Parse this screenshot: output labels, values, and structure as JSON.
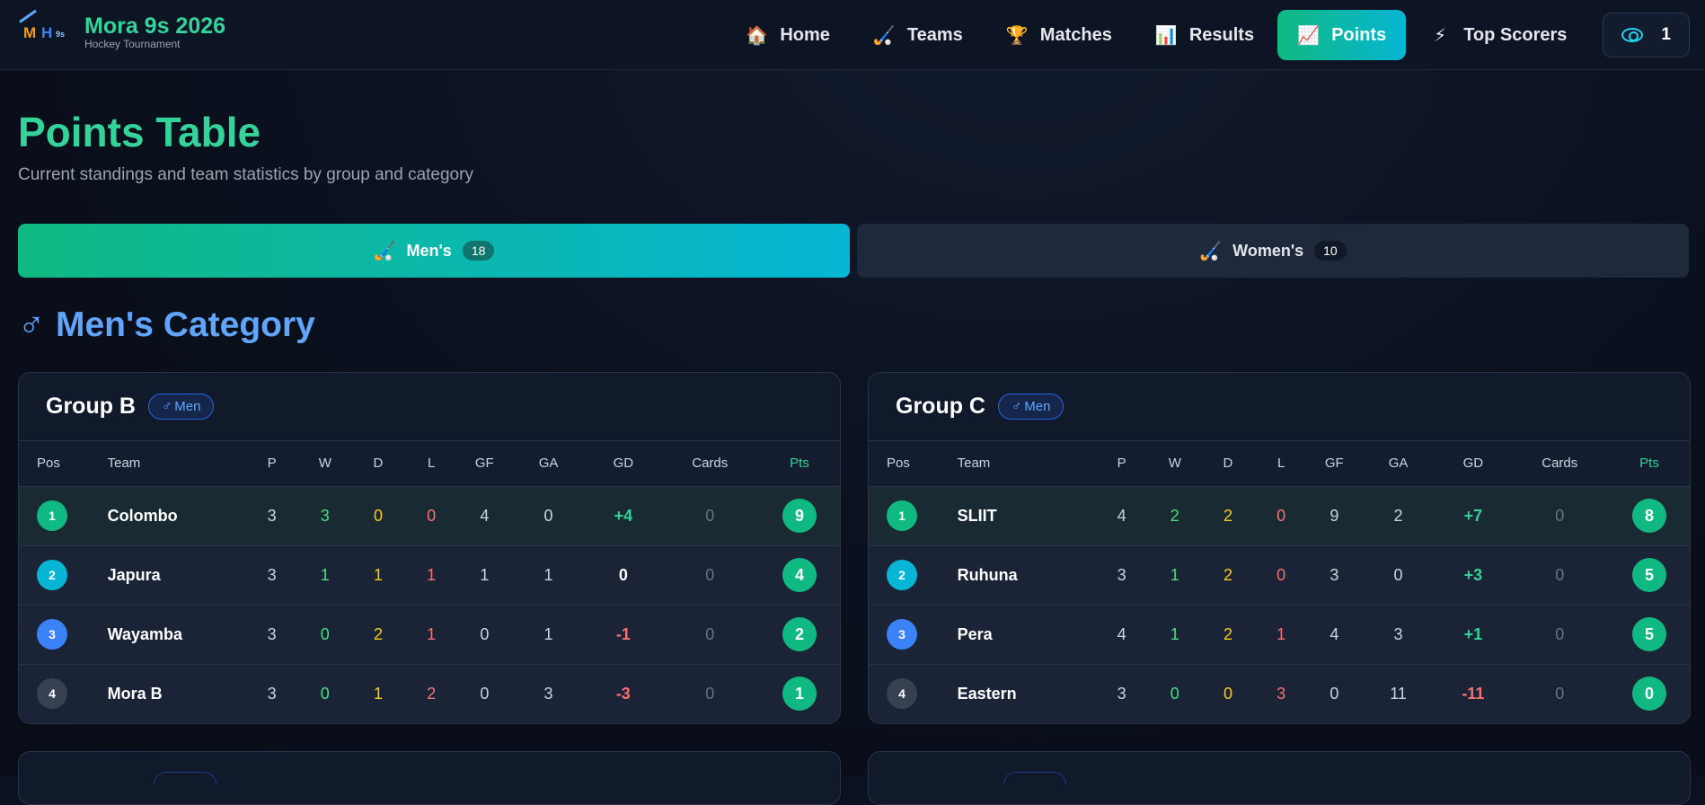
{
  "brand": {
    "logo_m": "M",
    "logo_h": "H",
    "logo_s": "9s",
    "title": "Mora 9s 2026",
    "subtitle": "Hockey Tournament"
  },
  "nav": {
    "items": [
      {
        "label": "Home",
        "icon": "house-icon",
        "glyph": "🏠"
      },
      {
        "label": "Teams",
        "icon": "hockey-stick-icon",
        "glyph": "🏑"
      },
      {
        "label": "Matches",
        "icon": "trophy-icon",
        "glyph": "🏆"
      },
      {
        "label": "Results",
        "icon": "bar-chart-icon",
        "glyph": "📊"
      },
      {
        "label": "Points",
        "icon": "line-chart-icon",
        "glyph": "📈",
        "active": true
      },
      {
        "label": "Top Scorers",
        "icon": "lightning-icon",
        "glyph": "⚡"
      }
    ],
    "visits": "1"
  },
  "page": {
    "title": "Points Table",
    "subtitle": "Current standings and team statistics by group and category"
  },
  "tabs": [
    {
      "label": "Men's",
      "count": "18",
      "glyph": "🏑",
      "active": true
    },
    {
      "label": "Women's",
      "count": "10",
      "glyph": "🏑",
      "active": false
    }
  ],
  "category": {
    "symbol": "♂",
    "label": "Men's Category"
  },
  "columns": [
    "Pos",
    "Team",
    "P",
    "W",
    "D",
    "L",
    "GF",
    "GA",
    "GD",
    "Cards",
    "Pts"
  ],
  "groups": [
    {
      "name": "Group B",
      "badge_symbol": "♂",
      "badge": "Men",
      "rows": [
        {
          "pos": "1",
          "team": "Colombo",
          "p": "3",
          "w": "3",
          "d": "0",
          "l": "0",
          "gf": "4",
          "ga": "0",
          "gd": "+4",
          "cards": "0",
          "pts": "9"
        },
        {
          "pos": "2",
          "team": "Japura",
          "p": "3",
          "w": "1",
          "d": "1",
          "l": "1",
          "gf": "1",
          "ga": "1",
          "gd": "0",
          "cards": "0",
          "pts": "4"
        },
        {
          "pos": "3",
          "team": "Wayamba",
          "p": "3",
          "w": "0",
          "d": "2",
          "l": "1",
          "gf": "0",
          "ga": "1",
          "gd": "-1",
          "cards": "0",
          "pts": "2"
        },
        {
          "pos": "4",
          "team": "Mora B",
          "p": "3",
          "w": "0",
          "d": "1",
          "l": "2",
          "gf": "0",
          "ga": "3",
          "gd": "-3",
          "cards": "0",
          "pts": "1"
        }
      ]
    },
    {
      "name": "Group C",
      "badge_symbol": "♂",
      "badge": "Men",
      "rows": [
        {
          "pos": "1",
          "team": "SLIIT",
          "p": "4",
          "w": "2",
          "d": "2",
          "l": "0",
          "gf": "9",
          "ga": "2",
          "gd": "+7",
          "cards": "0",
          "pts": "8"
        },
        {
          "pos": "2",
          "team": "Ruhuna",
          "p": "3",
          "w": "1",
          "d": "2",
          "l": "0",
          "gf": "3",
          "ga": "0",
          "gd": "+3",
          "cards": "0",
          "pts": "5"
        },
        {
          "pos": "3",
          "team": "Pera",
          "p": "4",
          "w": "1",
          "d": "2",
          "l": "1",
          "gf": "4",
          "ga": "3",
          "gd": "+1",
          "cards": "0",
          "pts": "5"
        },
        {
          "pos": "4",
          "team": "Eastern",
          "p": "3",
          "w": "0",
          "d": "0",
          "l": "3",
          "gf": "0",
          "ga": "11",
          "gd": "-11",
          "cards": "0",
          "pts": "0"
        }
      ]
    }
  ],
  "colors": {
    "accent": "#34d399",
    "accent2": "#06b6d4",
    "pos1": "#10b981",
    "pos2": "#06b6d4",
    "pos3": "#3b82f6",
    "pos4": "#374151"
  }
}
